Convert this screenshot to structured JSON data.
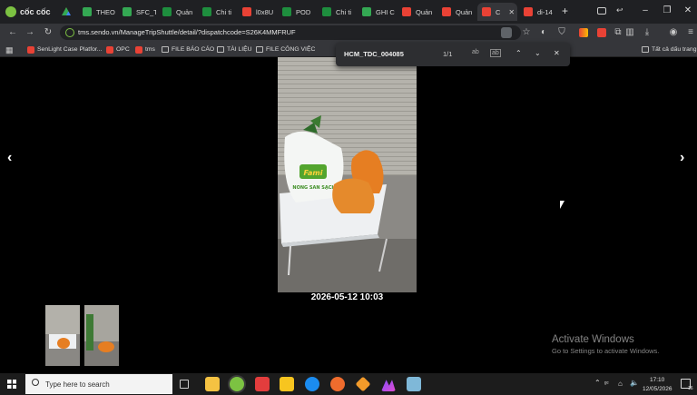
{
  "browser": {
    "brand": "cốc cốc",
    "tabs": [
      {
        "label": "THEO",
        "color": "#34a853"
      },
      {
        "label": "SFC_T",
        "color": "#34a853"
      },
      {
        "label": "Quản",
        "color": "#1e8e3e"
      },
      {
        "label": "Chi ti",
        "color": "#1e8e3e"
      },
      {
        "label": "l0x8U",
        "color": "#e94235"
      },
      {
        "label": "POD",
        "color": "#1e8e3e"
      },
      {
        "label": "Chi ti",
        "color": "#1e8e3e"
      },
      {
        "label": "GHI C",
        "color": "#34a853"
      },
      {
        "label": "Quản",
        "color": "#e94235"
      },
      {
        "label": "Quản",
        "color": "#e94235"
      },
      {
        "label": "C",
        "color": "#e94235",
        "active": true
      },
      {
        "label": "di-14",
        "color": "#e94235"
      }
    ],
    "url": "tms.sendo.vn/ManageTripShuttle/detail/?dispatchcode=S26K4MMFRUF",
    "bookmarks": [
      "SenLight Case Platfor...",
      "OPC",
      "tms",
      "FILE BÁO CÁO",
      "TÀI LIỆU",
      "FILE CÔNG VIỆC"
    ],
    "bookmarks_right": "Tất cả dấu trang"
  },
  "find_bar": {
    "query": "HCM_TDC_004085",
    "count": "1/1",
    "opt1": "ab",
    "opt2": "ab"
  },
  "viewer": {
    "bag_label": "NONG SAN SẠCH",
    "bag_brand": "Fami",
    "timestamp": "2026-05-12 10:03",
    "prev": "‹",
    "next": "›"
  },
  "watermark": {
    "line1": "Activate Windows",
    "line2": "Go to Settings to activate Windows."
  },
  "taskbar": {
    "search_placeholder": "Type here to search",
    "time": "17:10",
    "date": "12/05/2026",
    "notif_count": "16"
  }
}
